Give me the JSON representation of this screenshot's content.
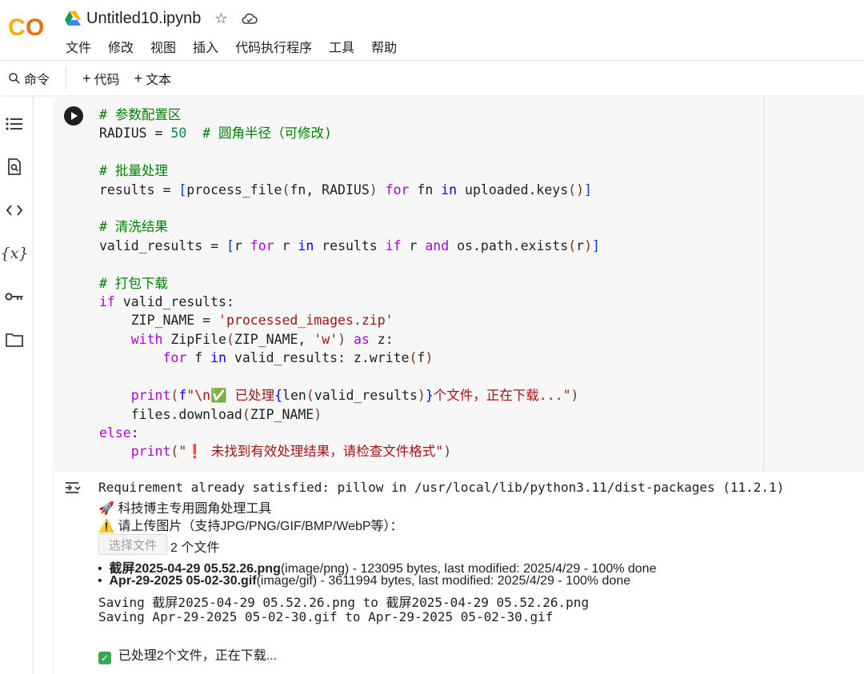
{
  "app": {
    "logo_text": "CO",
    "notebook_title": "Untitled10.ipynb"
  },
  "menu": [
    "文件",
    "修改",
    "视图",
    "插入",
    "代码执行程序",
    "工具",
    "帮助"
  ],
  "toolbar": {
    "command_label": "命令",
    "add_code_label": "代码",
    "add_text_label": "文本"
  },
  "sidebar": {
    "icons": [
      "toc-icon",
      "find-icon",
      "code-snippets-icon",
      "variables-icon",
      "secrets-key-icon",
      "files-folder-icon"
    ]
  },
  "code_lines": [
    "# 参数配置区",
    "RADIUS = 50  # 圆角半径（可修改)",
    "",
    "# 批量处理",
    "results = [process_file(fn, RADIUS) for fn in uploaded.keys()]",
    "",
    "# 清洗结果",
    "valid_results = [r for r in results if r and os.path.exists(r)]",
    "",
    "# 打包下载",
    "if valid_results:",
    "    ZIP_NAME = 'processed_images.zip'",
    "    with ZipFile(ZIP_NAME, 'w') as z:",
    "        for f in valid_results: z.write(f)",
    "",
    "    print(f\"\\n✅ 已处理{len(valid_results)}个文件，正在下载...\")",
    "    files.download(ZIP_NAME)",
    "else:",
    "    print(\"❗ 未找到有效处理结果，请检查文件格式\")"
  ],
  "output": {
    "requirement_line": "Requirement already satisfied: pillow in /usr/local/lib/python3.11/dist-packages (11.2.1)",
    "tool_line": "🚀 科技博主专用圆角处理工具",
    "upload_prompt": "⚠️ 请上传图片（支持JPG/PNG/GIF/BMP/WebP等）：",
    "choose_file_label": "选择文件",
    "file_count": "2 个文件",
    "files": [
      {
        "name": "截屏2025-04-29 05.52.26.png",
        "detail": "(image/png) - 123095 bytes, last modified: 2025/4/29 - 100% done"
      },
      {
        "name": "Apr-29-2025 05-02-30.gif",
        "detail": "(image/gif) - 3611994 bytes, last modified: 2025/4/29 - 100% done"
      }
    ],
    "saving_lines": [
      "Saving 截屏2025-04-29 05.52.26.png to 截屏2025-04-29 05.52.26.png",
      "Saving Apr-29-2025 05-02-30.gif to Apr-29-2025 05-02-30.gif"
    ],
    "done_line": "已处理2个文件，正在下载..."
  },
  "colors": {
    "logo_orange": "#f9ab00",
    "logo_dark_orange": "#e8710a",
    "run_button": "#1f1f1f",
    "comment": "#008000",
    "keyword": "#0000ff",
    "string": "#a31515",
    "number": "#098658"
  }
}
